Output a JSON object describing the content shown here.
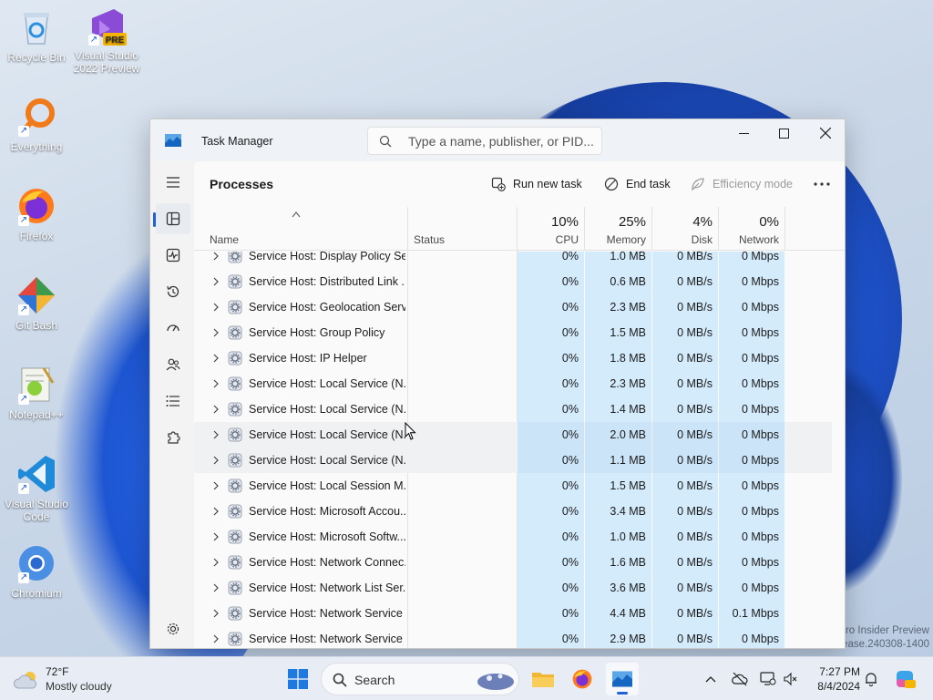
{
  "desktop": {
    "icons": [
      {
        "label": "Recycle Bin"
      },
      {
        "label": "Visual Studio 2022 Preview",
        "badge": "PRE"
      },
      {
        "label": "Everything"
      },
      {
        "label": "Firefox"
      },
      {
        "label": "Git Bash"
      },
      {
        "label": "Notepad++"
      },
      {
        "label": "Visual Studio Code"
      },
      {
        "label": "Chromium"
      }
    ],
    "watermark": {
      "line1": "ro Insider Preview",
      "line2": "ease.240308-1400"
    }
  },
  "window": {
    "title": "Task Manager",
    "search_placeholder": "Type a name, publisher, or PID...",
    "page_title": "Processes",
    "commands": {
      "run_new_task": "Run new task",
      "end_task": "End task",
      "efficiency_mode": "Efficiency mode"
    },
    "columns": {
      "name": "Name",
      "status": "Status",
      "cpu": {
        "label": "CPU",
        "pct": "10%"
      },
      "memory": {
        "label": "Memory",
        "pct": "25%"
      },
      "disk": {
        "label": "Disk",
        "pct": "4%"
      },
      "network": {
        "label": "Network",
        "pct": "0%"
      }
    },
    "rows": [
      {
        "name": "Service Host: Display Policy Se...",
        "cpu": "0%",
        "mem": "1.0 MB",
        "disk": "0 MB/s",
        "net": "0 Mbps"
      },
      {
        "name": "Service Host: Distributed Link ...",
        "cpu": "0%",
        "mem": "0.6 MB",
        "disk": "0 MB/s",
        "net": "0 Mbps"
      },
      {
        "name": "Service Host: Geolocation Serv...",
        "cpu": "0%",
        "mem": "2.3 MB",
        "disk": "0 MB/s",
        "net": "0 Mbps"
      },
      {
        "name": "Service Host: Group Policy",
        "cpu": "0%",
        "mem": "1.5 MB",
        "disk": "0 MB/s",
        "net": "0 Mbps"
      },
      {
        "name": "Service Host: IP Helper",
        "cpu": "0%",
        "mem": "1.8 MB",
        "disk": "0 MB/s",
        "net": "0 Mbps"
      },
      {
        "name": "Service Host: Local Service (N...",
        "cpu": "0%",
        "mem": "2.3 MB",
        "disk": "0 MB/s",
        "net": "0 Mbps"
      },
      {
        "name": "Service Host: Local Service (N...",
        "cpu": "0%",
        "mem": "1.4 MB",
        "disk": "0 MB/s",
        "net": "0 Mbps"
      },
      {
        "name": "Service Host: Local Service (N...",
        "cpu": "0%",
        "mem": "2.0 MB",
        "disk": "0 MB/s",
        "net": "0 Mbps"
      },
      {
        "name": "Service Host: Local Service (N...",
        "cpu": "0%",
        "mem": "1.1 MB",
        "disk": "0 MB/s",
        "net": "0 Mbps"
      },
      {
        "name": "Service Host: Local Session M...",
        "cpu": "0%",
        "mem": "1.5 MB",
        "disk": "0 MB/s",
        "net": "0 Mbps"
      },
      {
        "name": "Service Host: Microsoft Accou...",
        "cpu": "0%",
        "mem": "3.4 MB",
        "disk": "0 MB/s",
        "net": "0 Mbps"
      },
      {
        "name": "Service Host: Microsoft Softw...",
        "cpu": "0%",
        "mem": "1.0 MB",
        "disk": "0 MB/s",
        "net": "0 Mbps"
      },
      {
        "name": "Service Host: Network Connec...",
        "cpu": "0%",
        "mem": "1.6 MB",
        "disk": "0 MB/s",
        "net": "0 Mbps"
      },
      {
        "name": "Service Host: Network List Ser...",
        "cpu": "0%",
        "mem": "3.6 MB",
        "disk": "0 MB/s",
        "net": "0 Mbps"
      },
      {
        "name": "Service Host: Network Service",
        "cpu": "0%",
        "mem": "4.4 MB",
        "disk": "0 MB/s",
        "net": "0.1 Mbps"
      },
      {
        "name": "Service Host: Network Service",
        "cpu": "0%",
        "mem": "2.9 MB",
        "disk": "0 MB/s",
        "net": "0 Mbps"
      }
    ]
  },
  "taskbar": {
    "weather": {
      "temp": "72°F",
      "desc": "Mostly cloudy"
    },
    "search_label": "Search",
    "clock": {
      "time": "7:27 PM",
      "date": "8/4/2024"
    }
  },
  "colors": {
    "accent": "#2060d8",
    "cell_highlight": "#d4ebfc"
  }
}
